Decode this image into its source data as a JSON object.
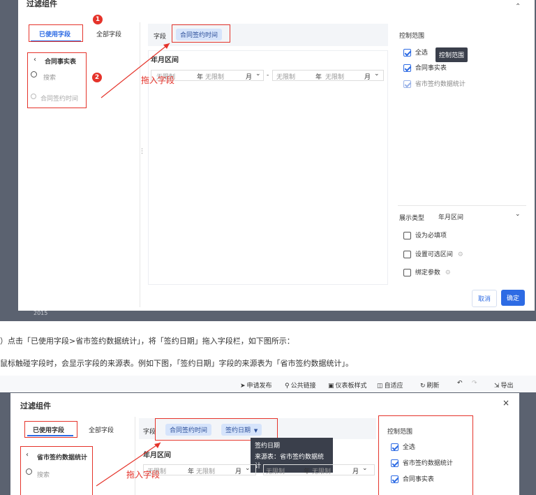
{
  "shot1": {
    "dialog_title": "过滤组件",
    "tabs": {
      "used": "已使用字段",
      "all": "全部字段"
    },
    "badge1": "1",
    "badge2": "2",
    "table_name": "合同事实表",
    "search_placeholder": "搜索",
    "field_item": "合同签约时间",
    "field_label": "字段",
    "field_pill": "合同签约时间",
    "section_title": "年月区间",
    "range": {
      "no_limit": "无限制",
      "year": "年",
      "month": "月",
      "sep": "-"
    },
    "drag_label": "拖入字段",
    "control_title": "控制范围",
    "control_items": [
      "全选",
      "合同事实表",
      "省市签约数据统计"
    ],
    "tooltip": "控制范围",
    "display_type_label": "展示类型",
    "display_type_value": "年月区间",
    "options": [
      "设为必填项",
      "设置可选区间",
      "绑定参数"
    ],
    "cancel": "取消",
    "confirm": "确定",
    "bg_text": "2015"
  },
  "doc": {
    "line1": "）点击「已使用字段>省市签约数据统计」，将「签约日期」拖入字段栏，如下图所示：",
    "line2": "鼠标触碰字段时，会显示字段的来源表。例如下图，「签约日期」字段的来源表为「省市签约数据统计」。"
  },
  "shot2": {
    "toolbar": [
      "申请发布",
      "公共链接",
      "仪表板样式",
      "自适应",
      "刷新",
      "导出"
    ],
    "dialog_title": "过滤组件",
    "close": "×",
    "tabs": {
      "used": "已使用字段",
      "all": "全部字段"
    },
    "table_name": "省市签约数据统计",
    "search_placeholder": "搜索",
    "field_label": "字段",
    "pills": [
      "合同签约时间",
      "签约日期"
    ],
    "tooltip_title": "签约日期",
    "tooltip_source": "来源表：省市签约数据统计",
    "section_title": "年月区间",
    "range": {
      "no_limit": "无限制",
      "year": "年",
      "month": "月",
      "sep": "-"
    },
    "drag_label": "拖入字段",
    "control_title": "控制范围",
    "control_items": [
      "全选",
      "省市签约数据统计",
      "合同事实表"
    ]
  }
}
